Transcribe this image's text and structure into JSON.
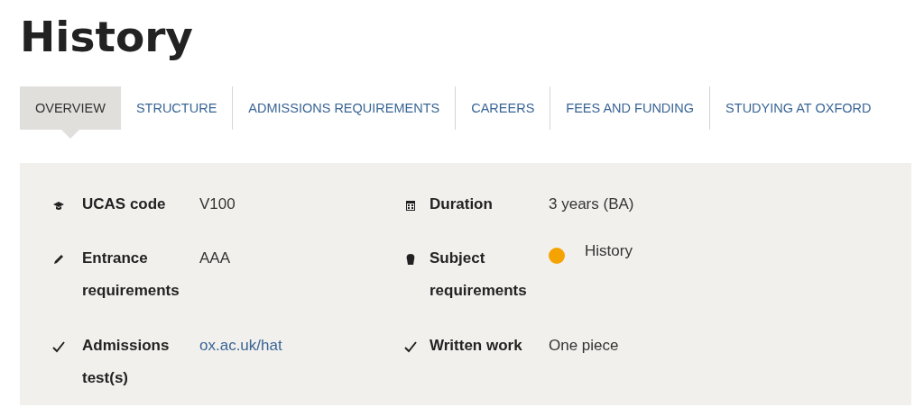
{
  "title": "History",
  "tabs": [
    {
      "label": "OVERVIEW",
      "selected": true
    },
    {
      "label": "STRUCTURE",
      "selected": false
    },
    {
      "label": "ADMISSIONS REQUIREMENTS",
      "selected": false
    },
    {
      "label": "CAREERS",
      "selected": false
    },
    {
      "label": "FEES AND FUNDING",
      "selected": false
    },
    {
      "label": "STUDYING AT OXFORD",
      "selected": false
    }
  ],
  "facts": [
    {
      "label": "UCAS code",
      "value": "V100",
      "kind": "text"
    },
    {
      "label": "Duration",
      "value": "3 years (BA)",
      "kind": "text"
    },
    {
      "label": "Entrance requirements",
      "value": "AAA",
      "kind": "text"
    },
    {
      "label": "Subject requirements",
      "value": "History",
      "kind": "dot",
      "color": "#f5a300"
    },
    {
      "label": "Admissions test(s)",
      "value": "ox.ac.uk/hat",
      "kind": "link"
    },
    {
      "label": "Written work",
      "value": "One piece",
      "kind": "text"
    }
  ]
}
